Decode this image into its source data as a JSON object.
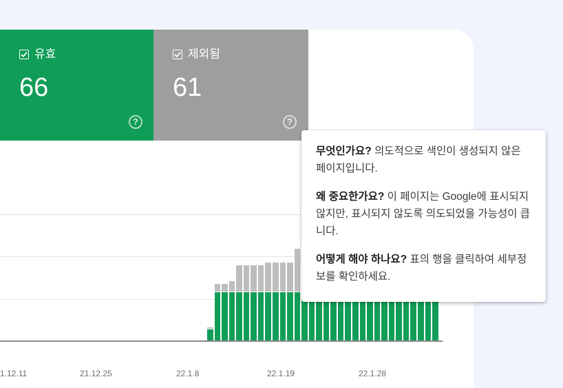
{
  "tiles": {
    "valid": {
      "label": "유효",
      "count": "66",
      "color": "#109d58",
      "checked": true,
      "help_icon": "help-circle-icon"
    },
    "excluded": {
      "label": "제외됨",
      "count": "61",
      "color": "#9e9e9e",
      "checked": true,
      "help_icon": "help-circle-icon"
    }
  },
  "chart_data": {
    "type": "bar",
    "stacked": true,
    "title": "",
    "xlabel": "",
    "ylabel": "",
    "x_tick_labels": [
      "1.12.11",
      "21.12.25",
      "22.1.8",
      "22.1.19",
      "22.1.28"
    ],
    "series": [
      {
        "color": "#109d58",
        "values": [
          2,
          9,
          9,
          9,
          9,
          9,
          9,
          9,
          9,
          9,
          9,
          9,
          9,
          9,
          9,
          9,
          9,
          9,
          9,
          9,
          9,
          9,
          9,
          9,
          9,
          9,
          9,
          9,
          9,
          9,
          9,
          9
        ]
      },
      {
        "color": "#bdbdbd",
        "values": [
          0.5,
          1.5,
          1.5,
          2.0,
          5.0,
          5.0,
          5.0,
          5.0,
          5.5,
          5.5,
          5.5,
          5.5,
          8.0,
          8.0,
          8.0,
          8.0,
          8.0,
          8.0,
          8.0,
          8.0,
          8.0,
          8.0,
          8.0,
          8.0,
          8.0,
          8.0,
          8.0,
          8.0,
          8.0,
          8.0,
          8.0,
          8.0
        ]
      }
    ],
    "grid": true
  },
  "tooltip": {
    "q1": "무엇인가요?",
    "a1": " 의도적으로 색인이 생성되지 않은 페이지입니다.",
    "q2": "왜 중요한가요?",
    "a2": " 이 페이지는 Google에 표시되지 않지만, 표시되지 않도록 의도되었을 가능성이 큽니다.",
    "q3": "어떻게 해야 하나요?",
    "a3": " 표의 행을 클릭하여 세부정보를 확인하세요."
  }
}
